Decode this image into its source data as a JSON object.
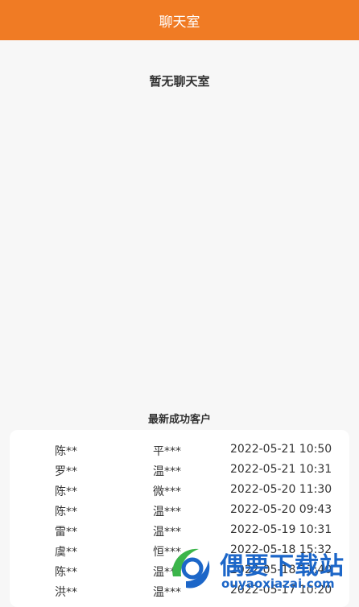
{
  "header": {
    "title": "聊天室"
  },
  "empty_state": {
    "text": "暂无聊天室"
  },
  "recent_customers": {
    "title": "最新成功客户",
    "rows": [
      {
        "name": "陈**",
        "contact": "平***",
        "time": "2022-05-21 10:50"
      },
      {
        "name": "罗**",
        "contact": "温***",
        "time": "2022-05-21 10:31"
      },
      {
        "name": "陈**",
        "contact": "微***",
        "time": "2022-05-20 11:30"
      },
      {
        "name": "陈**",
        "contact": "温***",
        "time": "2022-05-20 09:43"
      },
      {
        "name": "雷**",
        "contact": "温***",
        "time": "2022-05-19 10:31"
      },
      {
        "name": "虞**",
        "contact": "恒***",
        "time": "2022-05-18 15:32"
      },
      {
        "name": "陈**",
        "contact": "温***",
        "time": "2022-05-18 11:40"
      },
      {
        "name": "洪**",
        "contact": "温***",
        "time": "2022-05-17 10:20"
      }
    ]
  },
  "watermark": {
    "brand": "偶要下载站",
    "url": "ouyaoxiazai.com",
    "colors": {
      "blue": "#1c66c8",
      "green": "#3bb54a"
    }
  },
  "colors": {
    "accent": "#f07b24",
    "background": "#f7f7f7"
  }
}
